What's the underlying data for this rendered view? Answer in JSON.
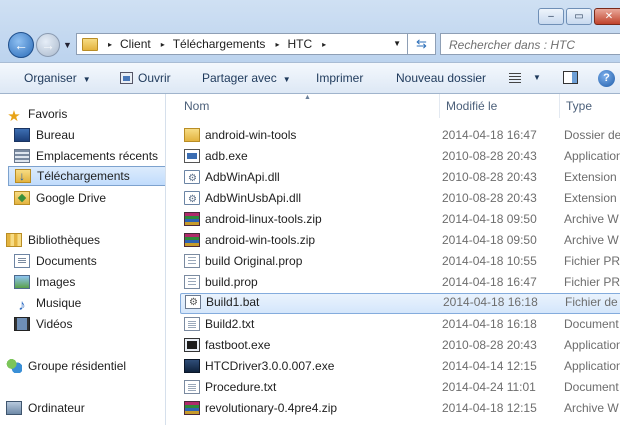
{
  "window": {
    "min_glyph": "–",
    "max_glyph": "▭",
    "close_glyph": "✕"
  },
  "address_bar": {
    "crumbs": [
      "Client",
      "Téléchargements",
      "HTC"
    ],
    "separator": "▸"
  },
  "search": {
    "placeholder": "Rechercher dans : HTC"
  },
  "toolbar": {
    "organize": "Organiser",
    "open": "Ouvrir",
    "share": "Partager avec",
    "print": "Imprimer",
    "new_folder": "Nouveau dossier"
  },
  "sidebar": {
    "favorites": {
      "title": "Favoris",
      "items": [
        "Bureau",
        "Emplacements récents",
        "Téléchargements",
        "Google Drive"
      ]
    },
    "libraries": {
      "title": "Bibliothèques",
      "items": [
        "Documents",
        "Images",
        "Musique",
        "Vidéos"
      ]
    },
    "homegroup": "Groupe résidentiel",
    "computer": "Ordinateur"
  },
  "columns": {
    "name": "Nom",
    "modified": "Modifié le",
    "type": "Type"
  },
  "files": [
    {
      "name": "android-win-tools",
      "date": "2014-04-18 16:47",
      "type": "Dossier de",
      "icon": "folder-icon"
    },
    {
      "name": "adb.exe",
      "date": "2010-08-28 20:43",
      "type": "Application",
      "icon": "exe-icon"
    },
    {
      "name": "AdbWinApi.dll",
      "date": "2010-08-28 20:43",
      "type": "Extension de",
      "icon": "dll-icon"
    },
    {
      "name": "AdbWinUsbApi.dll",
      "date": "2010-08-28 20:43",
      "type": "Extension de",
      "icon": "dll-icon"
    },
    {
      "name": "android-linux-tools.zip",
      "date": "2014-04-18 09:50",
      "type": "Archive W",
      "icon": "zip-icon"
    },
    {
      "name": "android-win-tools.zip",
      "date": "2014-04-18 09:50",
      "type": "Archive W",
      "icon": "zip-icon"
    },
    {
      "name": "build Original.prop",
      "date": "2014-04-18 10:55",
      "type": "Fichier PRO",
      "icon": "prop-icon"
    },
    {
      "name": "build.prop",
      "date": "2014-04-18 16:47",
      "type": "Fichier PRO",
      "icon": "prop-icon"
    },
    {
      "name": "Build1.bat",
      "date": "2014-04-18 16:18",
      "type": "Fichier de",
      "icon": "bat-icon"
    },
    {
      "name": "Build2.txt",
      "date": "2014-04-18 16:18",
      "type": "Document",
      "icon": "txt-icon"
    },
    {
      "name": "fastboot.exe",
      "date": "2010-08-28 20:43",
      "type": "Application",
      "icon": "exe-icon"
    },
    {
      "name": "HTCDriver3.0.0.007.exe",
      "date": "2014-04-14 12:15",
      "type": "Application",
      "icon": "installer-icon"
    },
    {
      "name": "Procedure.txt",
      "date": "2014-04-24 11:01",
      "type": "Document",
      "icon": "txt-icon"
    },
    {
      "name": "revolutionary-0.4pre4.zip",
      "date": "2014-04-18 12:15",
      "type": "Archive W",
      "icon": "zip-icon"
    }
  ],
  "selected_file": "Build1.bat",
  "selected_nav": "Téléchargements"
}
